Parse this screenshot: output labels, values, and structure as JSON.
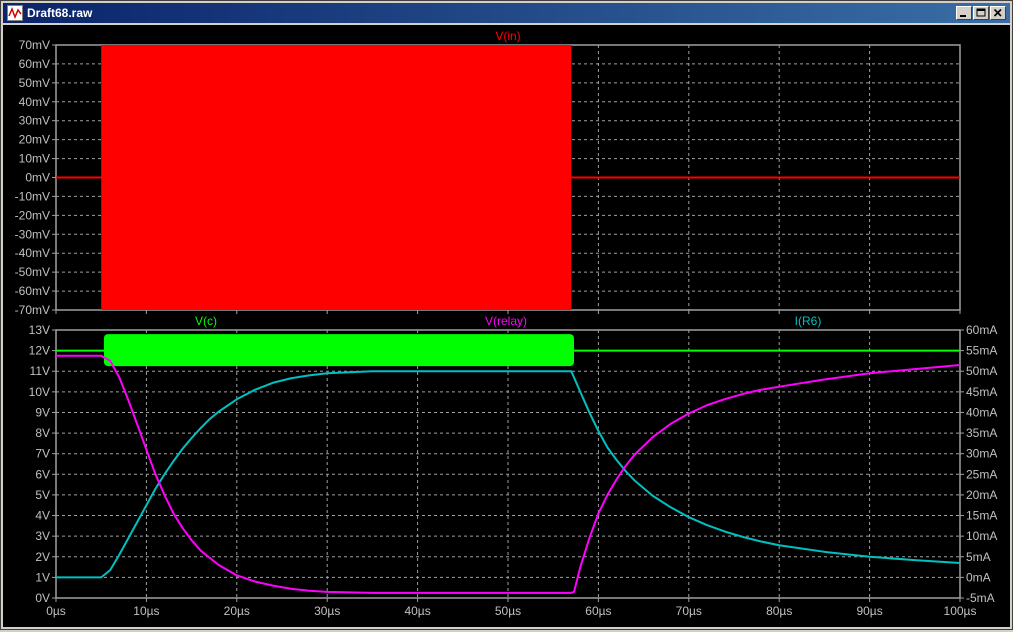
{
  "window": {
    "title": "Draft68.raw",
    "buttons": {
      "minimize": "minimize",
      "maximize": "maximize",
      "close": "close"
    }
  },
  "colors": {
    "background": "#000000",
    "grid": "#a0a0a0",
    "axis_text": "#c0c0c0",
    "vin": "#ff0000",
    "vc": "#00ff00",
    "vrelay": "#ff00ff",
    "ir6": "#00c0c0"
  },
  "chart_data": [
    {
      "type": "line",
      "pane": "top",
      "series": [
        {
          "name": "V(in)",
          "color": "#ff0000",
          "burst": {
            "x_start": 5,
            "x_end": 57,
            "amplitude": 70,
            "baseline": 0
          }
        }
      ],
      "x_ticks": [
        "0µs",
        "10µs",
        "20µs",
        "30µs",
        "40µs",
        "50µs",
        "60µs",
        "70µs",
        "80µs",
        "90µs",
        "100µs"
      ],
      "xlim": [
        0,
        100
      ],
      "y_ticks": [
        "70mV",
        "60mV",
        "50mV",
        "40mV",
        "30mV",
        "20mV",
        "10mV",
        "0mV",
        "-10mV",
        "-20mV",
        "-30mV",
        "-40mV",
        "-50mV",
        "-60mV",
        "-70mV"
      ],
      "ylim": [
        -70,
        70
      ],
      "grid": true
    },
    {
      "type": "line",
      "pane": "bottom",
      "series": [
        {
          "name": "V(c)",
          "color": "#00ff00",
          "axis": "left",
          "x": [
            0,
            5,
            5.3,
            57,
            57.3,
            100
          ],
          "y": [
            12,
            12,
            12,
            12,
            12,
            12
          ],
          "oscillation": {
            "x_start": 5.3,
            "x_end": 57.3,
            "min": 11.25,
            "max": 12.8
          }
        },
        {
          "name": "V(relay)",
          "color": "#ff00ff",
          "axis": "left",
          "x": [
            0,
            5,
            6,
            7,
            8,
            9,
            10,
            11,
            12,
            13,
            14,
            15,
            16,
            18,
            20,
            22,
            24,
            26,
            28,
            30,
            35,
            40,
            45,
            50,
            57,
            57.3,
            58,
            59,
            60,
            61,
            62,
            63,
            64,
            66,
            68,
            70,
            72,
            74,
            76,
            78,
            80,
            85,
            90,
            95,
            100
          ],
          "y": [
            11.75,
            11.75,
            11.5,
            10.7,
            9.6,
            8.4,
            7.2,
            6.0,
            5.0,
            4.1,
            3.4,
            2.8,
            2.3,
            1.6,
            1.1,
            0.8,
            0.6,
            0.45,
            0.35,
            0.3,
            0.25,
            0.25,
            0.25,
            0.25,
            0.25,
            0.3,
            1.5,
            2.9,
            4.1,
            5.0,
            5.75,
            6.4,
            6.95,
            7.8,
            8.45,
            8.95,
            9.35,
            9.65,
            9.9,
            10.1,
            10.25,
            10.6,
            10.9,
            11.1,
            11.3
          ]
        },
        {
          "name": "I(R6)",
          "color": "#00c0c0",
          "axis": "right",
          "x": [
            0,
            5,
            6,
            7,
            8,
            9,
            10,
            11,
            12,
            13,
            14,
            15,
            16,
            17,
            18,
            20,
            22,
            24,
            26,
            28,
            30,
            35,
            40,
            45,
            50,
            57,
            58,
            59,
            60,
            61,
            62,
            63,
            64,
            66,
            68,
            70,
            72,
            74,
            76,
            78,
            80,
            85,
            90,
            95,
            100
          ],
          "y": [
            0,
            0,
            1.8,
            5.5,
            9.5,
            13.5,
            17.5,
            21.5,
            25,
            28.2,
            31.2,
            33.8,
            36.2,
            38.4,
            40.2,
            43.2,
            45.5,
            47.2,
            48.3,
            49.0,
            49.5,
            50,
            50,
            50,
            50,
            50,
            45,
            40,
            35.5,
            31.5,
            28.5,
            25.8,
            23.5,
            19.8,
            17,
            14.6,
            12.7,
            11.1,
            9.8,
            8.7,
            7.8,
            6.2,
            5.0,
            4.2,
            3.5
          ]
        }
      ],
      "x_ticks": [
        "0µs",
        "10µs",
        "20µs",
        "30µs",
        "40µs",
        "50µs",
        "60µs",
        "70µs",
        "80µs",
        "90µs",
        "100µs"
      ],
      "xlim": [
        0,
        100
      ],
      "y_ticks_left": [
        "13V",
        "12V",
        "11V",
        "10V",
        "9V",
        "8V",
        "7V",
        "6V",
        "5V",
        "4V",
        "3V",
        "2V",
        "1V",
        "0V"
      ],
      "ylim_left": [
        0,
        13
      ],
      "y_ticks_right": [
        "60mA",
        "55mA",
        "50mA",
        "45mA",
        "40mA",
        "35mA",
        "30mA",
        "25mA",
        "20mA",
        "15mA",
        "10mA",
        "5mA",
        "0mA",
        "-5mA"
      ],
      "ylim_right": [
        -5,
        60
      ],
      "grid": true
    }
  ]
}
